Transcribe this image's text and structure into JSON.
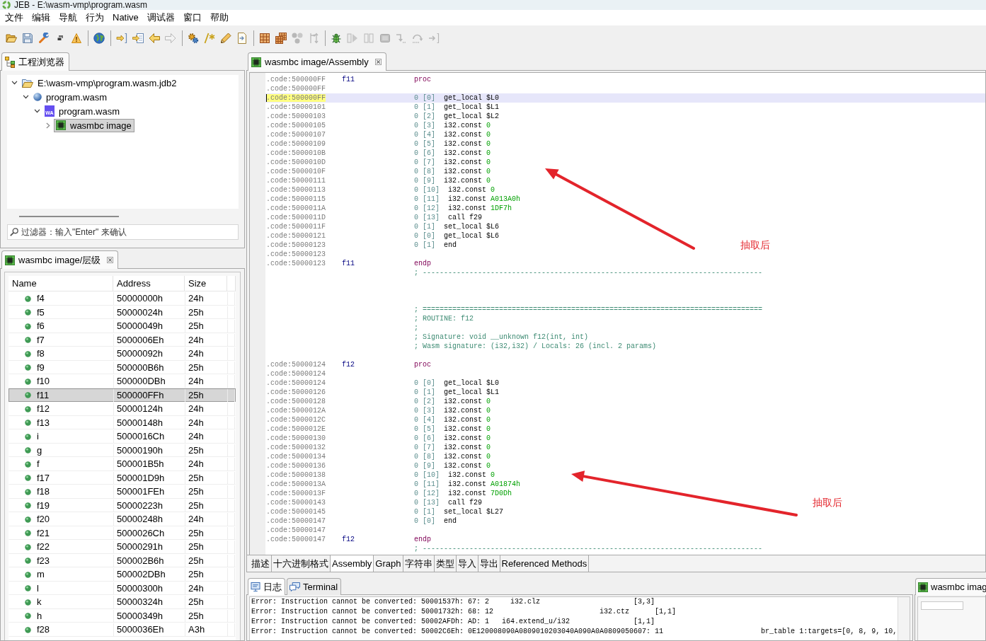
{
  "window": {
    "title": "JEB - E:\\wasm-vmp\\program.wasm"
  },
  "menu": [
    "文件",
    "编辑",
    "导航",
    "行为",
    "Native",
    "调试器",
    "窗口",
    "帮助"
  ],
  "toolbar": [
    [
      {
        "kind": "open",
        "disabled": false
      },
      {
        "kind": "save",
        "disabled": false
      },
      {
        "kind": "wrench",
        "disabled": false
      },
      {
        "kind": "windows",
        "disabled": false
      },
      {
        "kind": "warning",
        "disabled": false
      }
    ],
    [
      {
        "kind": "globe",
        "disabled": false
      }
    ],
    [
      {
        "kind": "jump",
        "disabled": false
      },
      {
        "kind": "import",
        "disabled": false
      },
      {
        "kind": "back",
        "disabled": false
      },
      {
        "kind": "forward",
        "disabled": true
      }
    ],
    [
      {
        "kind": "gears",
        "disabled": false
      },
      {
        "kind": "comment",
        "disabled": false
      },
      {
        "kind": "pencil",
        "disabled": false
      },
      {
        "kind": "doc",
        "disabled": false
      }
    ],
    [
      {
        "kind": "grid",
        "disabled": false
      },
      {
        "kind": "grid2",
        "disabled": false
      },
      {
        "kind": "nodes",
        "disabled": true
      },
      {
        "kind": "tree",
        "disabled": true
      }
    ],
    [
      {
        "kind": "bug",
        "disabled": false
      },
      {
        "kind": "play",
        "disabled": true
      },
      {
        "kind": "pause",
        "disabled": true
      },
      {
        "kind": "stop",
        "disabled": true
      },
      {
        "kind": "step_into",
        "disabled": true
      },
      {
        "kind": "step_over",
        "disabled": true
      },
      {
        "kind": "step_out",
        "disabled": true
      }
    ]
  ],
  "project_explorer": {
    "tab": "工程浏览器",
    "tree": [
      {
        "kind": "project",
        "label": "E:\\wasm-vmp\\program.wasm.jdb2",
        "expanded": true,
        "selected": false,
        "children": [
          {
            "kind": "artifact",
            "label": "program.wasm",
            "expanded": true,
            "selected": false,
            "children": [
              {
                "kind": "unit",
                "badge": "WA",
                "label": "program.wasm",
                "expanded": true,
                "selected": false,
                "children": [
                  {
                    "kind": "image",
                    "label": "wasmbc image",
                    "expanded": false,
                    "selected": true
                  }
                ]
              }
            ]
          }
        ]
      }
    ],
    "filter": {
      "placeholder": "过滤器：输入\"Enter\" 来确认"
    }
  },
  "hierarchy": {
    "tab": "wasmbc image/层级",
    "columns": [
      "Name",
      "Address",
      "Size"
    ],
    "rows": [
      {
        "name": "f4",
        "address": "50000000h",
        "size": "24h",
        "selected": false
      },
      {
        "name": "f5",
        "address": "50000024h",
        "size": "25h",
        "selected": false
      },
      {
        "name": "f6",
        "address": "50000049h",
        "size": "25h",
        "selected": false
      },
      {
        "name": "f7",
        "address": "5000006Eh",
        "size": "24h",
        "selected": false
      },
      {
        "name": "f8",
        "address": "50000092h",
        "size": "24h",
        "selected": false
      },
      {
        "name": "f9",
        "address": "500000B6h",
        "size": "25h",
        "selected": false
      },
      {
        "name": "f10",
        "address": "500000DBh",
        "size": "24h",
        "selected": false
      },
      {
        "name": "f11",
        "address": "500000FFh",
        "size": "25h",
        "selected": true
      },
      {
        "name": "f12",
        "address": "50000124h",
        "size": "24h",
        "selected": false
      },
      {
        "name": "f13",
        "address": "50000148h",
        "size": "24h",
        "selected": false
      },
      {
        "name": "i",
        "address": "5000016Ch",
        "size": "24h",
        "selected": false
      },
      {
        "name": "g",
        "address": "50000190h",
        "size": "25h",
        "selected": false
      },
      {
        "name": "f",
        "address": "500001B5h",
        "size": "24h",
        "selected": false
      },
      {
        "name": "f17",
        "address": "500001D9h",
        "size": "25h",
        "selected": false
      },
      {
        "name": "f18",
        "address": "500001FEh",
        "size": "25h",
        "selected": false
      },
      {
        "name": "f19",
        "address": "50000223h",
        "size": "25h",
        "selected": false
      },
      {
        "name": "f20",
        "address": "50000248h",
        "size": "24h",
        "selected": false
      },
      {
        "name": "f21",
        "address": "5000026Ch",
        "size": "25h",
        "selected": false
      },
      {
        "name": "f22",
        "address": "50000291h",
        "size": "25h",
        "selected": false
      },
      {
        "name": "f23",
        "address": "500002B6h",
        "size": "25h",
        "selected": false
      },
      {
        "name": "m",
        "address": "500002DBh",
        "size": "25h",
        "selected": false
      },
      {
        "name": "l",
        "address": "50000300h",
        "size": "24h",
        "selected": false
      },
      {
        "name": "k",
        "address": "50000324h",
        "size": "25h",
        "selected": false
      },
      {
        "name": "h",
        "address": "50000349h",
        "size": "25h",
        "selected": false
      },
      {
        "name": "f28",
        "address": "5000036Eh",
        "size": "A3h",
        "selected": false
      }
    ]
  },
  "editor": {
    "tab": "wasmbc image/Assembly",
    "lines": [
      {
        "kind": "directive",
        "address": ".code:500000FF",
        "label": "f11",
        "text": "proc",
        "selected": false
      },
      {
        "kind": "address",
        "address": ".code:500000FF",
        "selected": false
      },
      {
        "kind": "insn",
        "address": ".code:500000FF",
        "index": "0 [0]",
        "op": "get_local",
        "operand": "$L0",
        "literal": false,
        "selected": true
      },
      {
        "kind": "insn",
        "address": ".code:50000101",
        "index": "0 [1]",
        "op": "get_local",
        "operand": "$L1",
        "literal": false,
        "selected": false
      },
      {
        "kind": "insn",
        "address": ".code:50000103",
        "index": "0 [2]",
        "op": "get_local",
        "operand": "$L2",
        "literal": false,
        "selected": false
      },
      {
        "kind": "insn",
        "address": ".code:50000105",
        "index": "0 [3]",
        "op": "i32.const",
        "operand": "0",
        "literal": true,
        "selected": false
      },
      {
        "kind": "insn",
        "address": ".code:50000107",
        "index": "0 [4]",
        "op": "i32.const",
        "operand": "0",
        "literal": true,
        "selected": false
      },
      {
        "kind": "insn",
        "address": ".code:50000109",
        "index": "0 [5]",
        "op": "i32.const",
        "operand": "0",
        "literal": true,
        "selected": false
      },
      {
        "kind": "insn",
        "address": ".code:5000010B",
        "index": "0 [6]",
        "op": "i32.const",
        "operand": "0",
        "literal": true,
        "selected": false
      },
      {
        "kind": "insn",
        "address": ".code:5000010D",
        "index": "0 [7]",
        "op": "i32.const",
        "operand": "0",
        "literal": true,
        "selected": false
      },
      {
        "kind": "insn",
        "address": ".code:5000010F",
        "index": "0 [8]",
        "op": "i32.const",
        "operand": "0",
        "literal": true,
        "selected": false
      },
      {
        "kind": "insn",
        "address": ".code:50000111",
        "index": "0 [9]",
        "op": "i32.const",
        "operand": "0",
        "literal": true,
        "selected": false
      },
      {
        "kind": "insn",
        "address": ".code:50000113",
        "index": "0 [10]",
        "op": "i32.const",
        "operand": "0",
        "literal": true,
        "selected": false
      },
      {
        "kind": "insn",
        "address": ".code:50000115",
        "index": "0 [11]",
        "op": "i32.const",
        "operand": "A013A0h",
        "literal": true,
        "selected": false
      },
      {
        "kind": "insn",
        "address": ".code:5000011A",
        "index": "0 [12]",
        "op": "i32.const",
        "operand": "1DF7h",
        "literal": true,
        "selected": false
      },
      {
        "kind": "insn",
        "address": ".code:5000011D",
        "index": "0 [13]",
        "op": "call",
        "operand": "f29",
        "literal": false,
        "selected": false
      },
      {
        "kind": "insn",
        "address": ".code:5000011F",
        "index": "0 [1]",
        "op": "set_local",
        "operand": "$L6",
        "literal": false,
        "selected": false
      },
      {
        "kind": "insn",
        "address": ".code:50000121",
        "index": "0 [0]",
        "op": "get_local",
        "operand": "$L6",
        "literal": false,
        "selected": false
      },
      {
        "kind": "insn",
        "address": ".code:50000123",
        "index": "0 [1]",
        "op": "end",
        "selected": false
      },
      {
        "kind": "address",
        "address": ".code:50000123",
        "selected": false
      },
      {
        "kind": "directive",
        "address": ".code:50000123",
        "label": "f11",
        "text": "endp",
        "selected": false
      },
      {
        "kind": "comment",
        "text": "; --------------------------------------------------------------------------------",
        "selected": false
      },
      {
        "kind": "blank",
        "selected": false
      },
      {
        "kind": "blank",
        "selected": false
      },
      {
        "kind": "blank",
        "selected": false
      },
      {
        "kind": "comment",
        "text": "; ================================================================================",
        "selected": false
      },
      {
        "kind": "comment",
        "text": "; ROUTINE: f12",
        "selected": false
      },
      {
        "kind": "comment",
        "text": ";",
        "selected": false
      },
      {
        "kind": "comment",
        "text": "; Signature: void __unknown f12(int, int)",
        "selected": false
      },
      {
        "kind": "comment",
        "text": "; Wasm signature: (i32,i32) / Locals: 26 (incl. 2 params)",
        "selected": false
      },
      {
        "kind": "blank",
        "selected": false
      },
      {
        "kind": "directive",
        "address": ".code:50000124",
        "label": "f12",
        "text": "proc",
        "selected": false
      },
      {
        "kind": "address",
        "address": ".code:50000124",
        "selected": false
      },
      {
        "kind": "insn",
        "address": ".code:50000124",
        "index": "0 [0]",
        "op": "get_local",
        "operand": "$L0",
        "literal": false,
        "selected": false
      },
      {
        "kind": "insn",
        "address": ".code:50000126",
        "index": "0 [1]",
        "op": "get_local",
        "operand": "$L1",
        "literal": false,
        "selected": false
      },
      {
        "kind": "insn",
        "address": ".code:50000128",
        "index": "0 [2]",
        "op": "i32.const",
        "operand": "0",
        "literal": true,
        "selected": false
      },
      {
        "kind": "insn",
        "address": ".code:5000012A",
        "index": "0 [3]",
        "op": "i32.const",
        "operand": "0",
        "literal": true,
        "selected": false
      },
      {
        "kind": "insn",
        "address": ".code:5000012C",
        "index": "0 [4]",
        "op": "i32.const",
        "operand": "0",
        "literal": true,
        "selected": false
      },
      {
        "kind": "insn",
        "address": ".code:5000012E",
        "index": "0 [5]",
        "op": "i32.const",
        "operand": "0",
        "literal": true,
        "selected": false
      },
      {
        "kind": "insn",
        "address": ".code:50000130",
        "index": "0 [6]",
        "op": "i32.const",
        "operand": "0",
        "literal": true,
        "selected": false
      },
      {
        "kind": "insn",
        "address": ".code:50000132",
        "index": "0 [7]",
        "op": "i32.const",
        "operand": "0",
        "literal": true,
        "selected": false
      },
      {
        "kind": "insn",
        "address": ".code:50000134",
        "index": "0 [8]",
        "op": "i32.const",
        "operand": "0",
        "literal": true,
        "selected": false
      },
      {
        "kind": "insn",
        "address": ".code:50000136",
        "index": "0 [9]",
        "op": "i32.const",
        "operand": "0",
        "literal": true,
        "selected": false
      },
      {
        "kind": "insn",
        "address": ".code:50000138",
        "index": "0 [10]",
        "op": "i32.const",
        "operand": "0",
        "literal": true,
        "selected": false
      },
      {
        "kind": "insn",
        "address": ".code:5000013A",
        "index": "0 [11]",
        "op": "i32.const",
        "operand": "A01874h",
        "literal": true,
        "selected": false
      },
      {
        "kind": "insn",
        "address": ".code:5000013F",
        "index": "0 [12]",
        "op": "i32.const",
        "operand": "7D0Dh",
        "literal": true,
        "selected": false
      },
      {
        "kind": "insn",
        "address": ".code:50000143",
        "index": "0 [13]",
        "op": "call",
        "operand": "f29",
        "literal": false,
        "selected": false
      },
      {
        "kind": "insn",
        "address": ".code:50000145",
        "index": "0 [1]",
        "op": "set_local",
        "operand": "$L27",
        "literal": false,
        "selected": false
      },
      {
        "kind": "insn",
        "address": ".code:50000147",
        "index": "0 [0]",
        "op": "end",
        "selected": false
      },
      {
        "kind": "address",
        "address": ".code:50000147",
        "selected": false
      },
      {
        "kind": "directive",
        "address": ".code:50000147",
        "label": "f12",
        "text": "endp",
        "selected": false
      },
      {
        "kind": "comment",
        "text": "; --------------------------------------------------------------------------------",
        "selected": false
      }
    ],
    "annotations": [
      {
        "label": "抽取后"
      },
      {
        "label": "抽取后"
      }
    ],
    "view_tabs": [
      {
        "label": "描述",
        "selected": false
      },
      {
        "label": "十六进制格式",
        "selected": false
      },
      {
        "label": "Assembly",
        "selected": true
      },
      {
        "label": "Graph",
        "selected": false
      },
      {
        "label": "字符串",
        "selected": false
      },
      {
        "label": "类型",
        "selected": false
      },
      {
        "label": "导入",
        "selected": false
      },
      {
        "label": "导出",
        "selected": false
      },
      {
        "label": "Referenced Methods",
        "selected": false
      }
    ]
  },
  "log": {
    "tabs": [
      {
        "kind": "log",
        "label": "日志",
        "selected": true
      },
      {
        "kind": "terminal",
        "label": "Terminal",
        "selected": false
      }
    ],
    "lines": [
      "Error: Instruction cannot be converted: 50001537h: 67: 2     i32.clz                      [3,3]",
      "Error: Instruction cannot be converted: 50001732h: 68: 12                         i32.ctz      [1,1]",
      "Error: Instruction cannot be converted: 50002AFDh: AD: 1   i64.extend_u/i32               [1,1]",
      "Error: Instruction cannot be converted: 50002C6Eh: 0E120008090A0809010203040A090A0A0809050607: 11                       br_table 1:targets=[0, 8, 9, 10,"
    ]
  },
  "side_panel": {
    "tab": "wasmbc imag"
  }
}
